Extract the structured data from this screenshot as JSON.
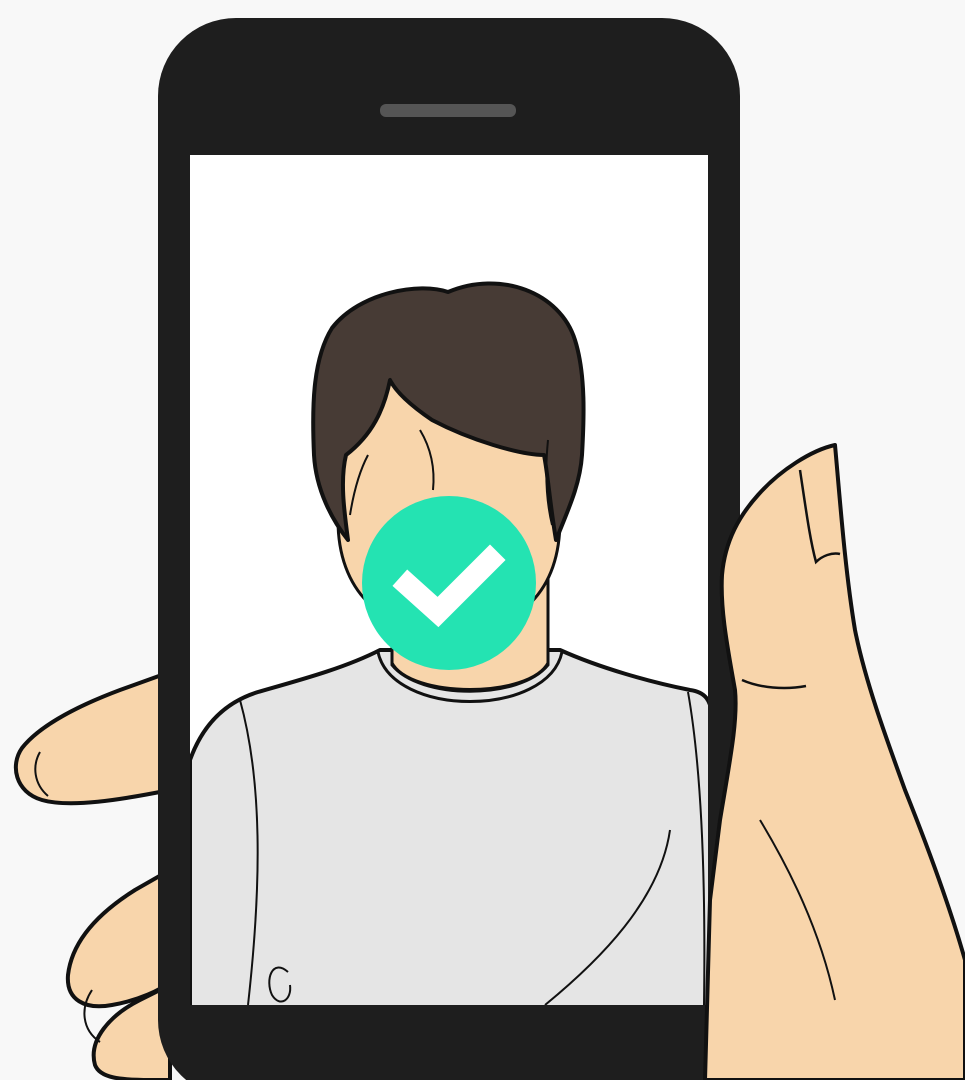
{
  "colors": {
    "background": "#f8f8f8",
    "phone_body": "#1e1e1e",
    "phone_speaker": "#555555",
    "screen": "#ffffff",
    "skin": "#f8d5ab",
    "hair": "#473b35",
    "shirt": "#e5e5e5",
    "outline": "#111111",
    "check_badge": "#24e3b2",
    "check_mark": "#ffffff"
  },
  "icons": {
    "verified_badge": "check-circle-icon"
  },
  "status": {
    "face_verified": true
  }
}
